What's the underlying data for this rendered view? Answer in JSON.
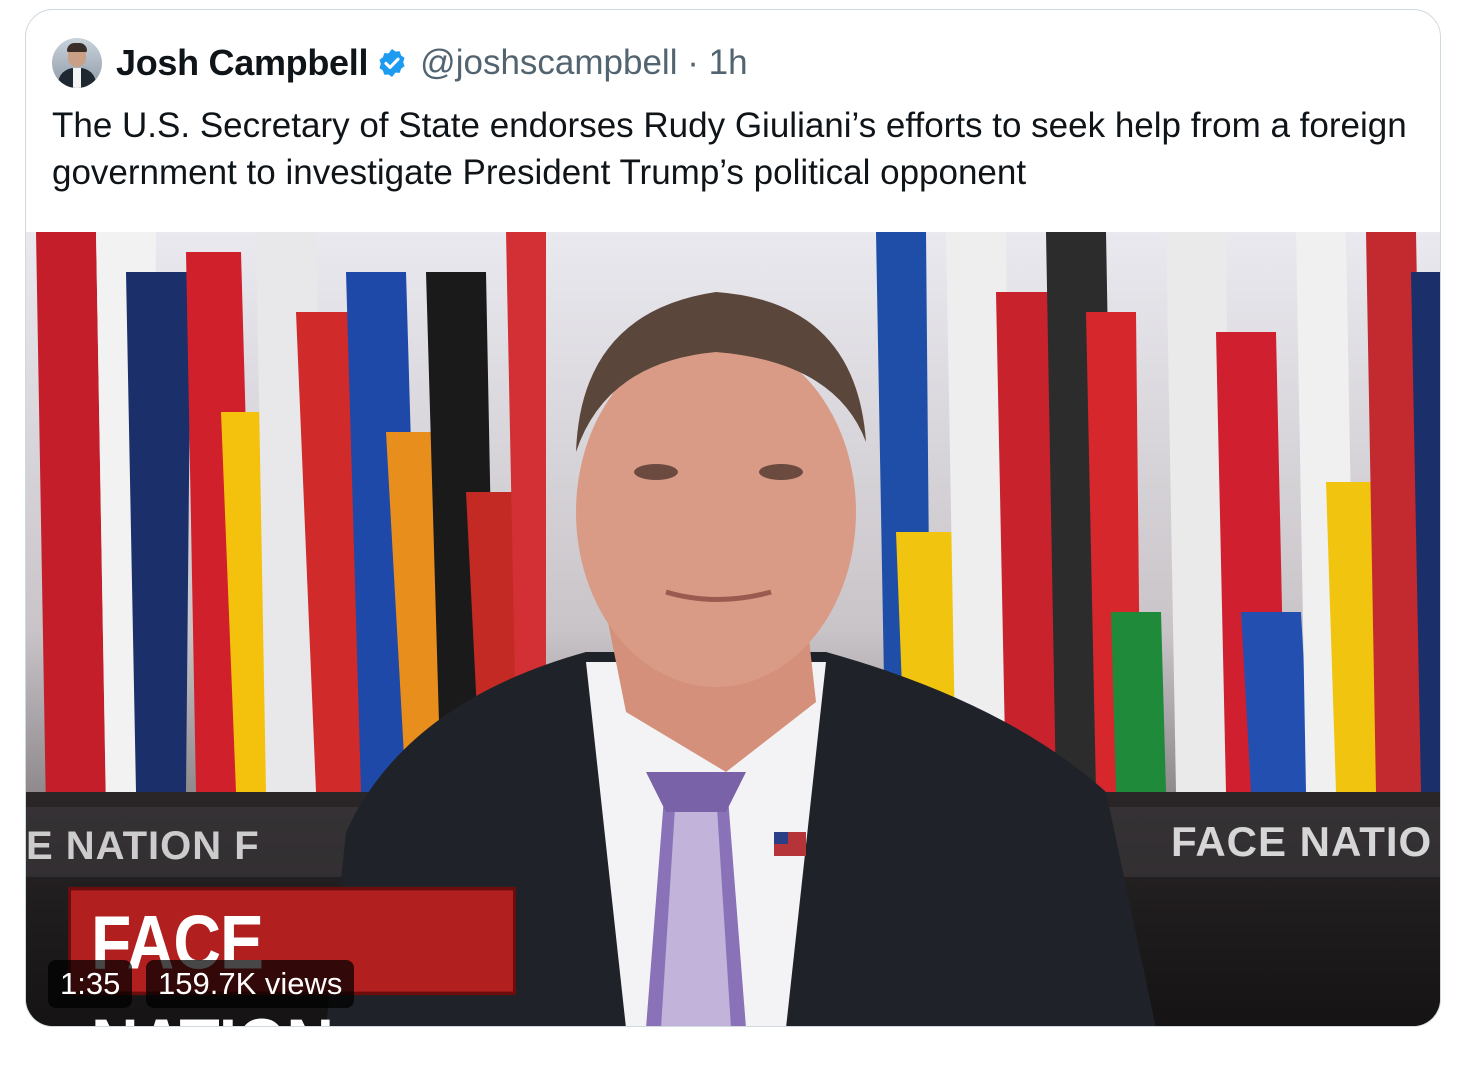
{
  "tweet": {
    "author_name": "Josh Campbell",
    "handle": "@joshscampbell",
    "separator": "·",
    "time": "1h",
    "text": "The U.S. Secretary of State endorses Rudy Giuliani’s efforts to seek help from a foreign government to investigate President Trump’s political opponent",
    "verified_color": "#1d9bf0"
  },
  "video": {
    "duration": "1:35",
    "views": "159.7K views",
    "lower_third": "FACE NATION",
    "backdrop_left": "E NATION F",
    "backdrop_right": "FACE NATIO"
  }
}
